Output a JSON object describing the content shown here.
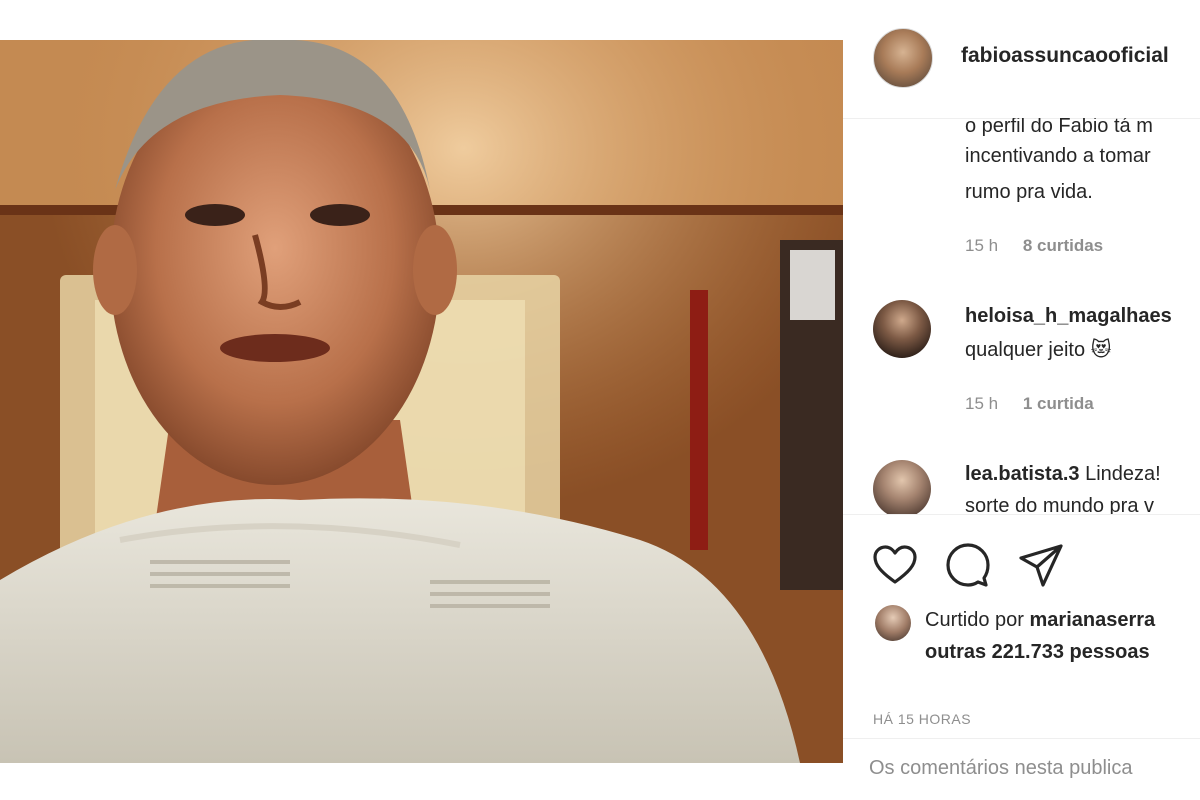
{
  "post": {
    "author": "fabioassuncaooficial",
    "comments": [
      {
        "user": "",
        "lines": [
          "o perfil do Fabio tá m",
          "incentivando a tomar",
          "rumo pra vida."
        ],
        "time": "15 h",
        "likes": "8 curtidas"
      },
      {
        "user": "heloisa_h_magalhaes",
        "lines": [
          "",
          "qualquer jeito 😻"
        ],
        "time": "15 h",
        "likes": "1 curtida"
      },
      {
        "user": "lea.batista.3",
        "lines": [
          "Lindeza!",
          "sorte do mundo pra v"
        ]
      }
    ],
    "liked_by_prefix": "Curtido por",
    "liked_by_user": "marianaserra",
    "liked_by_others": "outras 221.733 pessoas",
    "time_ago": "HÁ 15 HORAS",
    "comment_placeholder": "Os comentários nesta publica"
  },
  "icons": {
    "like": "heart-icon",
    "comment": "comment-bubble-icon",
    "share": "paper-plane-icon"
  }
}
